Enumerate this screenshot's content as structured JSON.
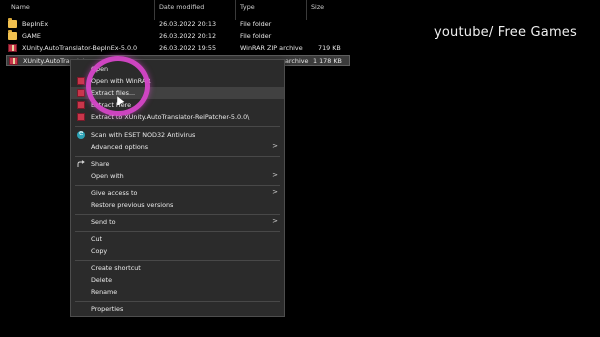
{
  "columns": {
    "name": "Name",
    "date": "Date modified",
    "type": "Type",
    "size": "Size"
  },
  "files": [
    {
      "name": "BepInEx",
      "date": "26.03.2022 20:13",
      "type": "File folder",
      "size": "",
      "icon": "folder-icon"
    },
    {
      "name": "GAME",
      "date": "26.03.2022 20:12",
      "type": "File folder",
      "size": "",
      "icon": "folder-icon"
    },
    {
      "name": "XUnity.AutoTranslator-BepInEx-5.0.0",
      "date": "26.03.2022 19:55",
      "type": "WinRAR ZIP archive",
      "size": "719 KB",
      "icon": "winrar-archive-icon"
    },
    {
      "name": "XUnity.AutoTranslat",
      "date": "",
      "type": "archive",
      "size": "1 178 KB",
      "icon": "winrar-archive-icon"
    }
  ],
  "watermark": "youtube/ Free Games",
  "context_menu": {
    "items": [
      {
        "label": "Open",
        "icon": ""
      },
      {
        "label": "Open with WinRAR",
        "icon": "winrar-icon"
      },
      {
        "label": "Extract files...",
        "icon": "winrar-icon"
      },
      {
        "label": "Extract Here",
        "icon": "winrar-icon"
      },
      {
        "label": "Extract to XUnity.AutoTranslator-ReiPatcher-5.0.0\\",
        "icon": "winrar-icon"
      },
      {
        "label": "Scan with ESET NOD32 Antivirus",
        "icon": "eset-icon"
      },
      {
        "label": "Advanced options",
        "icon": "",
        "submenu": true
      },
      {
        "label": "Share",
        "icon": "share-icon"
      },
      {
        "label": "Open with",
        "icon": "",
        "submenu": true
      },
      {
        "label": "Give access to",
        "icon": "",
        "submenu": true
      },
      {
        "label": "Restore previous versions",
        "icon": ""
      },
      {
        "label": "Send to",
        "icon": "",
        "submenu": true
      },
      {
        "label": "Cut",
        "icon": ""
      },
      {
        "label": "Copy",
        "icon": ""
      },
      {
        "label": "Create shortcut",
        "icon": ""
      },
      {
        "label": "Delete",
        "icon": ""
      },
      {
        "label": "Rename",
        "icon": ""
      },
      {
        "label": "Properties",
        "icon": ""
      }
    ],
    "submenu_arrow": ">"
  },
  "colors": {
    "background": "#000000",
    "menu_bg": "#2b2b2b",
    "highlight_ring": "#d646c8",
    "folder": "#f1c04f",
    "winrar": "#c9364b"
  }
}
